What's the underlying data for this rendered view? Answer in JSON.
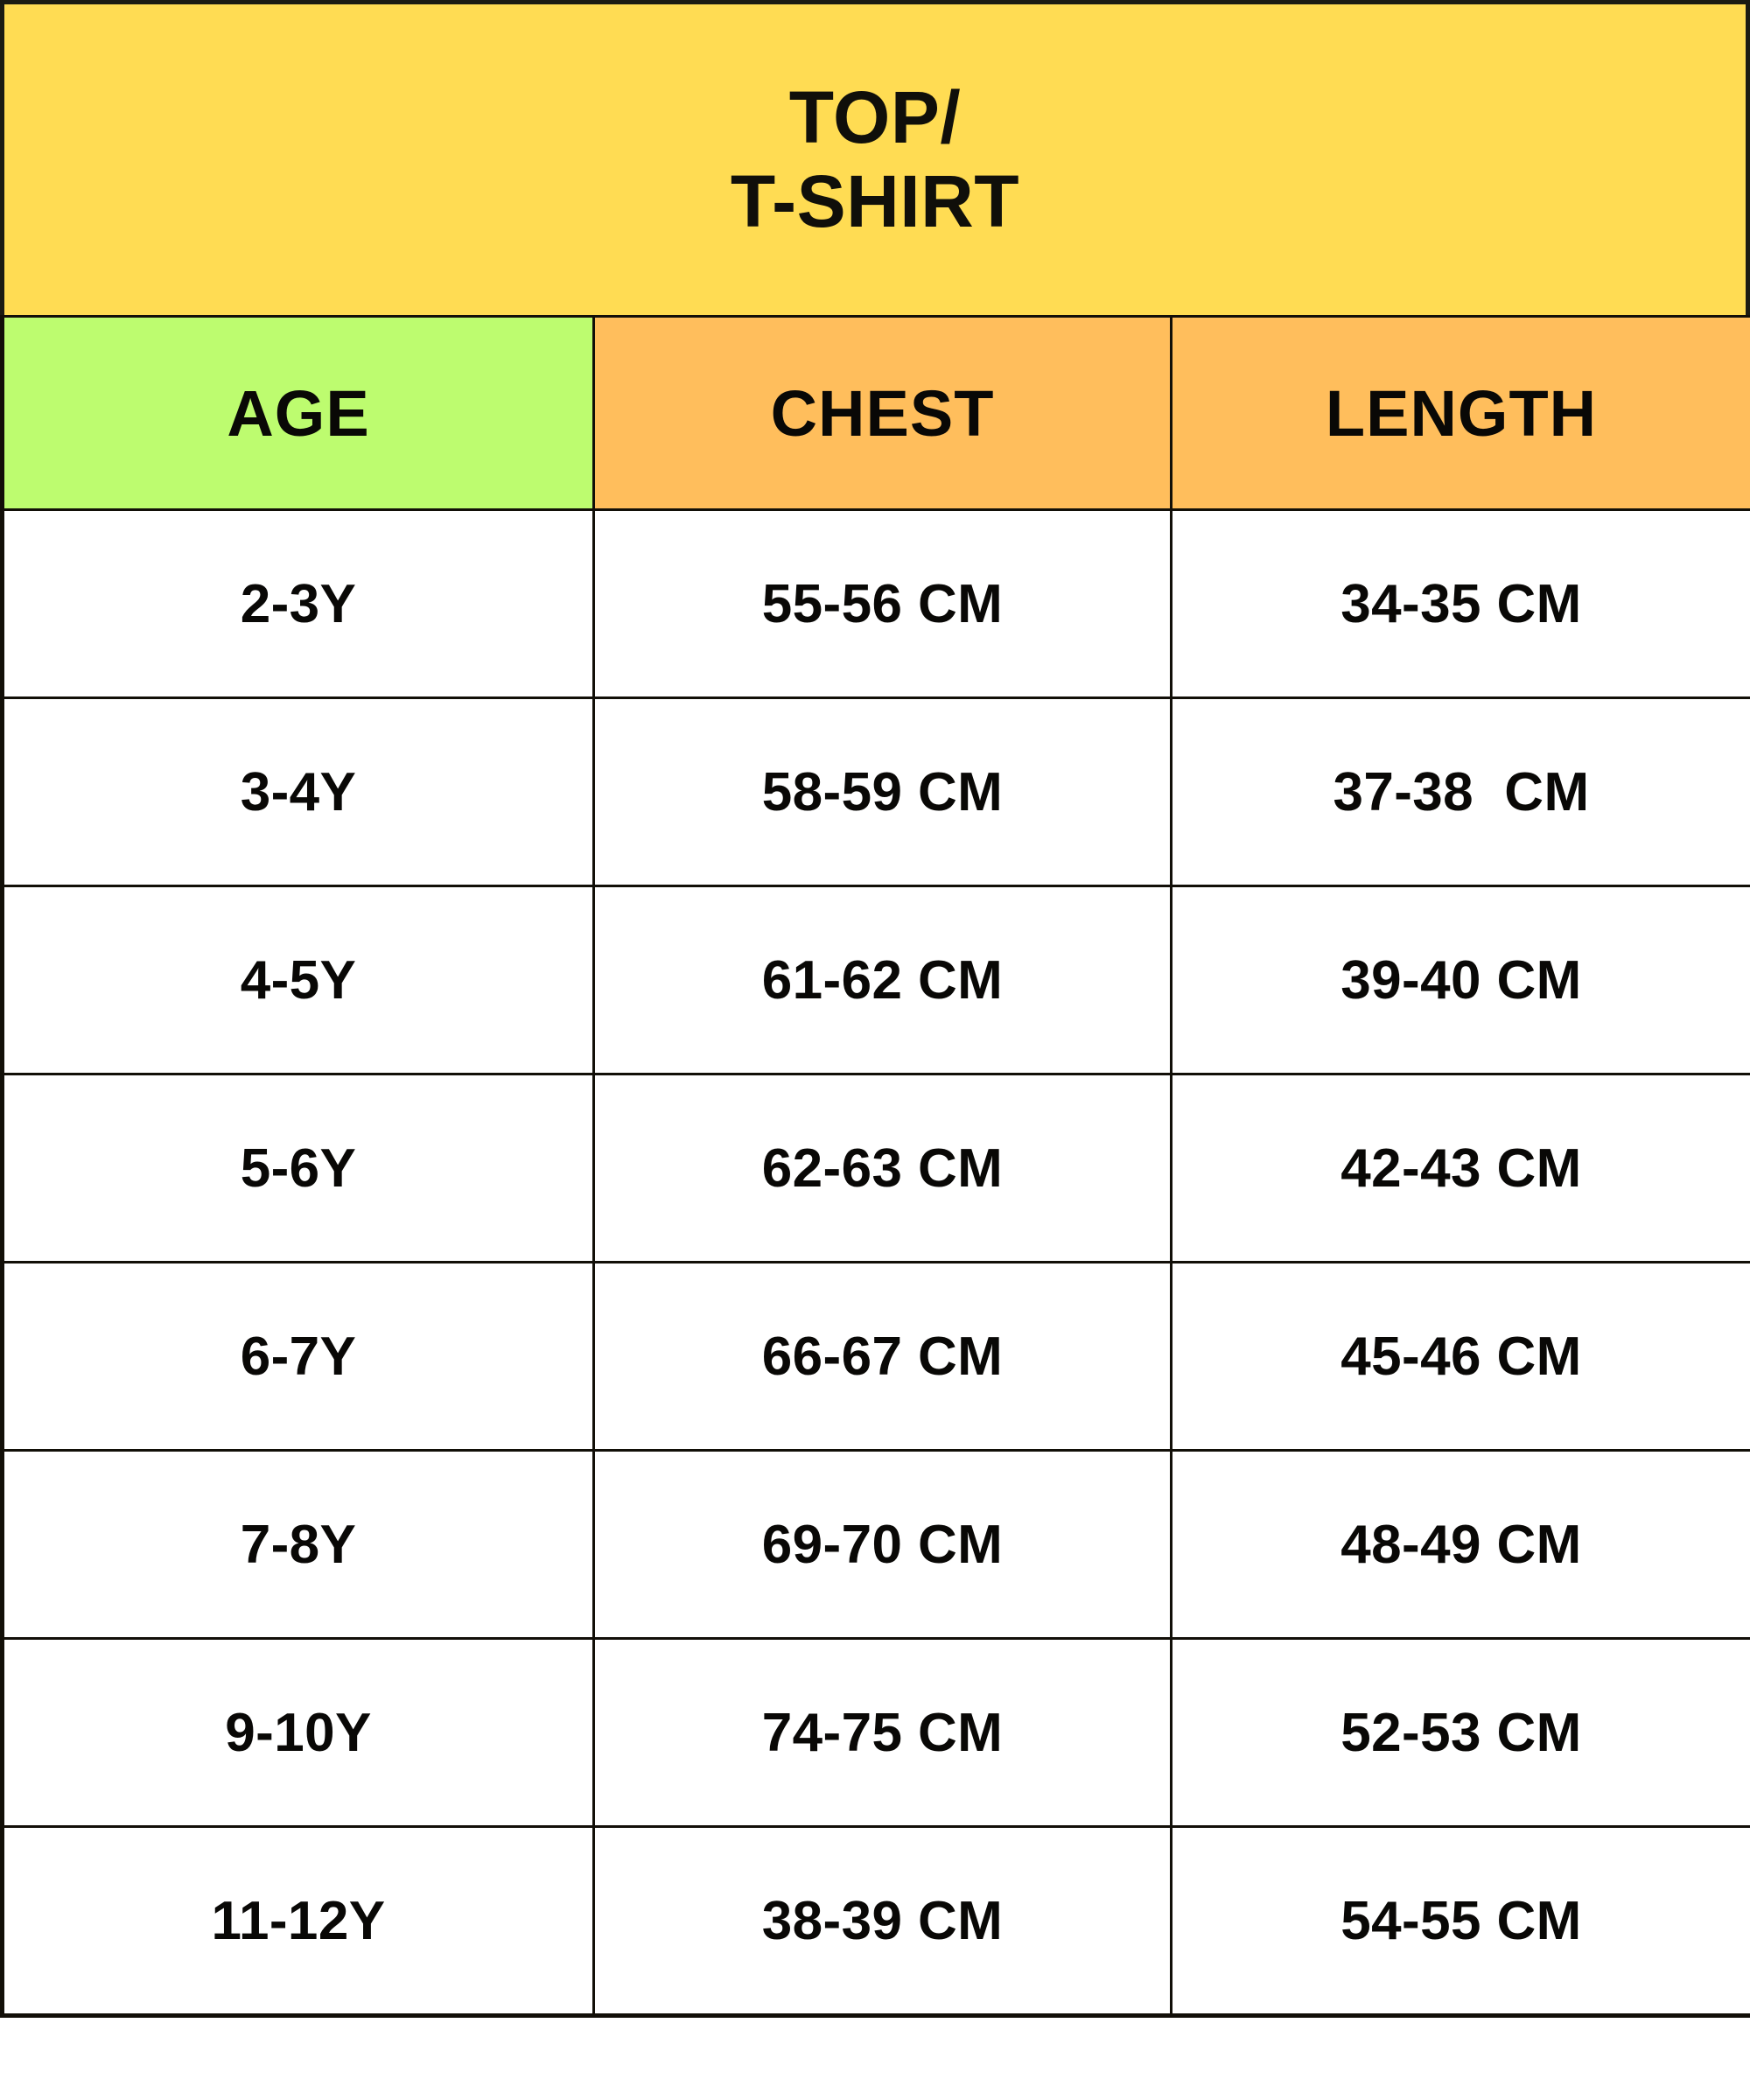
{
  "title": {
    "line1": "TOP/",
    "line2": "T-SHIRT"
  },
  "colors": {
    "title_background": "#FFDC53",
    "age_header_background": "#BDFC6F",
    "measure_header_background": "#FFBE5C",
    "cell_background": "#FFFFFF",
    "border": "#120F08",
    "text": "#090806"
  },
  "chart_data": {
    "type": "table",
    "title": "TOP/\nT-SHIRT",
    "columns": [
      "AGE",
      "CHEST",
      "LENGTH"
    ],
    "rows": [
      [
        "2-3Y",
        "55-56 CM",
        "34-35 CM"
      ],
      [
        "3-4Y",
        "58-59 CM",
        "37-38  CM"
      ],
      [
        "4-5Y",
        "61-62 CM",
        "39-40 CM"
      ],
      [
        "5-6Y",
        "62-63 CM",
        "42-43 CM"
      ],
      [
        "6-7Y",
        "66-67 CM",
        "45-46 CM"
      ],
      [
        "7-8Y",
        "69-70 CM",
        "48-49 CM"
      ],
      [
        "9-10Y",
        "74-75 CM",
        "52-53 CM"
      ],
      [
        "11-12Y",
        "38-39 CM",
        "54-55 CM"
      ]
    ]
  },
  "table": {
    "headers": {
      "age": "AGE",
      "chest": "CHEST",
      "length": "LENGTH"
    },
    "rows": [
      {
        "age": "2-3Y",
        "chest": "55-56 CM",
        "length": "34-35 CM"
      },
      {
        "age": "3-4Y",
        "chest": "58-59 CM",
        "length": "37-38  CM"
      },
      {
        "age": "4-5Y",
        "chest": "61-62 CM",
        "length": "39-40 CM"
      },
      {
        "age": "5-6Y",
        "chest": "62-63 CM",
        "length": "42-43 CM"
      },
      {
        "age": "6-7Y",
        "chest": "66-67 CM",
        "length": "45-46 CM"
      },
      {
        "age": "7-8Y",
        "chest": "69-70 CM",
        "length": "48-49 CM"
      },
      {
        "age": "9-10Y",
        "chest": "74-75 CM",
        "length": "52-53 CM"
      },
      {
        "age": "11-12Y",
        "chest": "38-39 CM",
        "length": "54-55 CM"
      }
    ]
  }
}
